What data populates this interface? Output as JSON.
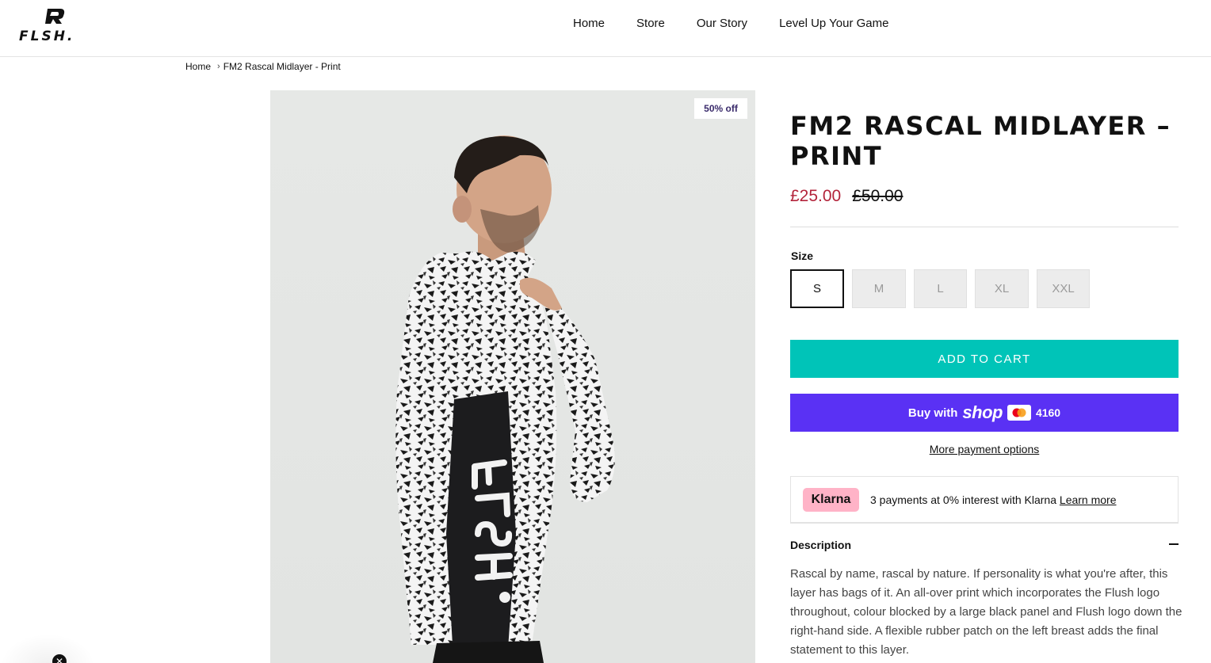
{
  "brand": {
    "logo_text": "FLSH."
  },
  "nav": {
    "items": [
      "Home",
      "Store",
      "Our Story",
      "Level Up Your Game"
    ]
  },
  "breadcrumb": {
    "home": "Home",
    "current": "FM2 Rascal Midlayer - Print"
  },
  "product": {
    "badge": "50% off",
    "title": "FM2 RASCAL MIDLAYER – PRINT",
    "price_sale": "£25.00",
    "price_original": "£50.00",
    "size_label": "Size",
    "sizes": [
      "S",
      "M",
      "L",
      "XL",
      "XXL"
    ],
    "selected_size": "S",
    "add_to_cart": "ADD TO CART",
    "shop_pay": {
      "prefix": "Buy with",
      "brand": "shop",
      "card_digits": "4160"
    },
    "more_payment": "More payment options",
    "klarna": {
      "badge": "Klarna",
      "text": "3 payments at 0% interest with Klarna",
      "link": "Learn more"
    },
    "description_heading": "Description",
    "description": "Rascal by name, rascal by nature. If personality is what you're after, this layer has bags of it. An all-over print which incorporates the Flush logo throughout, colour blocked by a large black panel and Flush logo down the right-hand side. A flexible rubber patch on the left breast adds the final statement to this layer."
  },
  "colors": {
    "accent_teal": "#00c4b8",
    "shop_purple": "#5a31f4",
    "sale_red": "#b3243b",
    "klarna_pink": "#ffb3c7"
  }
}
